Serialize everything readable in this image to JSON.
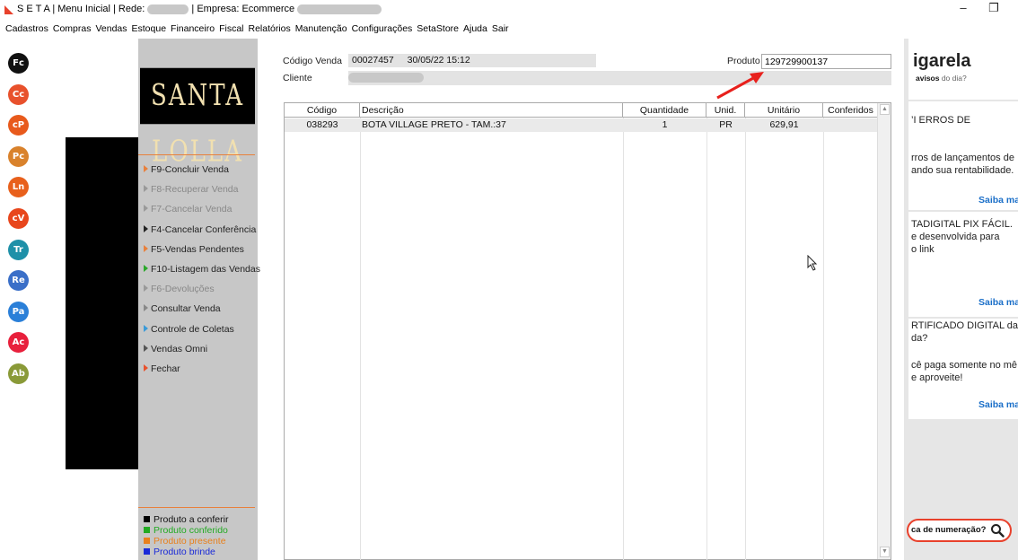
{
  "window": {
    "title_app": "S E T A | Menu Inicial | Rede:",
    "title_empresa": "| Empresa: Ecommerce",
    "minimize": "–",
    "restore": "❐"
  },
  "menubar": [
    "Cadastros",
    "Compras",
    "Vendas",
    "Estoque",
    "Financeiro",
    "Fiscal",
    "Relatórios",
    "Manutenção",
    "Configurações",
    "SetaStore",
    "Ajuda",
    "Sair"
  ],
  "shortcuts": [
    {
      "label": "Fc",
      "color": "#111111"
    },
    {
      "label": "Cc",
      "color": "#e8512c"
    },
    {
      "label": "cP",
      "color": "#e85a1c"
    },
    {
      "label": "Pc",
      "color": "#d9822c"
    },
    {
      "label": "Ln",
      "color": "#e8601c"
    },
    {
      "label": "cV",
      "color": "#e8461c"
    },
    {
      "label": "Tr",
      "color": "#1e90a8"
    },
    {
      "label": "Re",
      "color": "#3a6fc8"
    },
    {
      "label": "Pa",
      "color": "#2a7fd8"
    },
    {
      "label": "Ac",
      "color": "#e8203c"
    },
    {
      "label": "Ab",
      "color": "#8a9a38"
    }
  ],
  "brand": "SANTA LOLLA",
  "actions": [
    {
      "label": "F9-Concluir Venda",
      "color": "#222222",
      "arrow": "#e8803c"
    },
    {
      "label": "F8-Recuperar Venda",
      "color": "#888888",
      "arrow": "#999999"
    },
    {
      "label": "F7-Cancelar Venda",
      "color": "#888888",
      "arrow": "#999999"
    },
    {
      "label": "F4-Cancelar Conferência",
      "color": "#222222",
      "arrow": "#222222"
    },
    {
      "label": "F5-Vendas Pendentes",
      "color": "#222222",
      "arrow": "#e8803c"
    },
    {
      "label": "F10-Listagem das Vendas",
      "color": "#222222",
      "arrow": "#2aa82a"
    },
    {
      "label": "F6-Devoluções",
      "color": "#888888",
      "arrow": "#999999"
    },
    {
      "label": "Consultar Venda",
      "color": "#222222",
      "arrow": "#888888"
    },
    {
      "label": "Controle de Coletas",
      "color": "#222222",
      "arrow": "#3a9ad8"
    },
    {
      "label": "Vendas Omni",
      "color": "#222222",
      "arrow": "#555555"
    },
    {
      "label": "Fechar",
      "color": "#222222",
      "arrow": "#e8512c"
    }
  ],
  "legend": [
    {
      "label": "Produto a conferir",
      "color": "#000000"
    },
    {
      "label": "Produto conferido",
      "color": "#22aa22"
    },
    {
      "label": "Produto presente",
      "color": "#e8801c"
    },
    {
      "label": "Produto brinde",
      "color": "#1a2ad8"
    }
  ],
  "header": {
    "codigo_venda_label": "Código Venda",
    "codigo_venda_value": "00027457",
    "datetime": "30/05/22 15:12",
    "cliente_label": "Cliente",
    "produto_label": "Produto",
    "produto_value": "129729900137"
  },
  "table": {
    "columns": [
      "Código",
      "Descrição",
      "Quantidade",
      "Unid.",
      "Unitário",
      "Conferidos"
    ],
    "rows": [
      {
        "codigo": "038293",
        "descricao": "BOTA VILLAGE PRETO - TAM.:37",
        "quantidade": "1",
        "unid": "PR",
        "unitario": "629,91",
        "conferidos": ""
      }
    ]
  },
  "info_panel": {
    "brand": "igarela",
    "tagline_bold": "avisos",
    "tagline_rest": " do dia?",
    "item1_title": "’I ERROS DE",
    "item1_line1": "rros de lançamentos de",
    "item1_line2": "ando sua rentabilidade.",
    "item1_link": "Saiba mai",
    "item2_line1": "TADIGITAL PIX FÁCIL.",
    "item2_line2": "e desenvolvida para",
    "item2_line3": "o link",
    "item2_link": "Saiba mai",
    "item3_line1": "RTIFICADO DIGITAL da",
    "item3_line2": "da?",
    "item3_line3": "cê paga somente no mê",
    "item3_line4": "e aproveite!",
    "item3_link": "Saiba mai",
    "search_text": "ca de numeração?"
  }
}
